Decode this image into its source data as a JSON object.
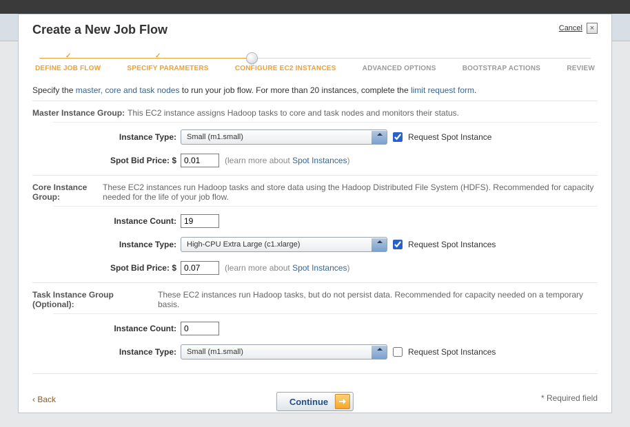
{
  "modal": {
    "title": "Create a New Job Flow",
    "cancel": "Cancel"
  },
  "wizard": {
    "steps": [
      "DEFINE JOB FLOW",
      "SPECIFY PARAMETERS",
      "CONFIGURE EC2 INSTANCES",
      "ADVANCED OPTIONS",
      "BOOTSTRAP ACTIONS",
      "REVIEW"
    ],
    "current_index": 2
  },
  "intro": {
    "prefix": "Specify the ",
    "link1": "master, core and task nodes",
    "mid": " to run your job flow. For more than 20 instances, complete the ",
    "link2": "limit request form",
    "suffix": "."
  },
  "master": {
    "title": "Master Instance Group:",
    "desc": "This EC2 instance assigns Hadoop tasks to core and task nodes and monitors their status.",
    "labels": {
      "type": "Instance Type:",
      "spot": "Spot Bid Price: $"
    },
    "type": "Small (m1.small)",
    "request_spot_checked": true,
    "request_spot_label": "Request Spot Instance",
    "spot_price": "0.01",
    "learn_prefix": "(learn more about ",
    "learn_link": "Spot Instances",
    "learn_suffix": ")"
  },
  "core": {
    "title": "Core Instance Group:",
    "desc": "These EC2 instances run Hadoop tasks and store data using the Hadoop Distributed File System (HDFS). Recommended for capacity needed for the life of your job flow.",
    "labels": {
      "count": "Instance Count:",
      "type": "Instance Type:",
      "spot": "Spot Bid Price: $"
    },
    "count": "19",
    "type": "High-CPU Extra Large (c1.xlarge)",
    "request_spot_checked": true,
    "request_spot_label": "Request Spot Instances",
    "spot_price": "0.07",
    "learn_prefix": "(learn more about ",
    "learn_link": "Spot Instances",
    "learn_suffix": ")"
  },
  "task": {
    "title": "Task Instance Group (Optional):",
    "desc": "These EC2 instances run Hadoop tasks, but do not persist data. Recommended for capacity needed on a temporary basis.",
    "labels": {
      "count": "Instance Count:",
      "type": "Instance Type:"
    },
    "count": "0",
    "type": "Small (m1.small)",
    "request_spot_checked": false,
    "request_spot_label": "Request Spot Instances"
  },
  "footer": {
    "back": "‹ Back",
    "continue": "Continue",
    "required": "* Required field"
  }
}
